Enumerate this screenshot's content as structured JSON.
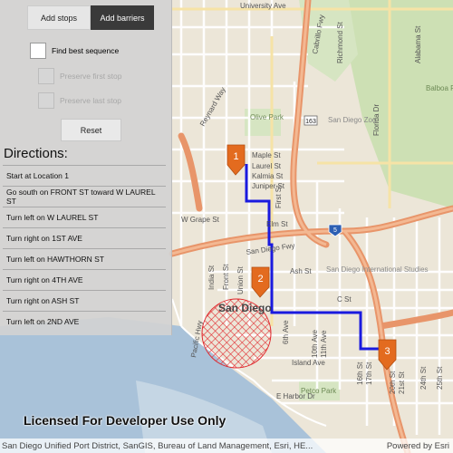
{
  "panel": {
    "tabs": [
      {
        "label": "Add stops",
        "active": false
      },
      {
        "label": "Add barriers",
        "active": true
      }
    ],
    "options": {
      "find_best_sequence": "Find best sequence",
      "preserve_first_stop": "Preserve first stop",
      "preserve_last_stop": "Preserve last stop"
    },
    "reset_label": "Reset",
    "directions_title": "Directions:",
    "directions": [
      "Start at Location 1",
      "Go south on FRONT ST toward W LAUREL ST",
      "Turn left on W LAUREL ST",
      "Turn right on 1ST AVE",
      "Turn left on HAWTHORN ST",
      "Turn right on 4TH AVE",
      "Turn right on ASH ST",
      "Turn left on 2ND AVE"
    ]
  },
  "map": {
    "stops": [
      "1",
      "2",
      "3"
    ],
    "city_label": "San Diego",
    "freeway_shield": "5",
    "route_shield": "163",
    "colors": {
      "route": "#1a1adf",
      "stop_marker": "#e36b1f",
      "barrier": "#e0262b",
      "freeway": "#e8956a",
      "water": "#a9c2d9",
      "park": "#cde0b4"
    },
    "labels": {
      "university_ave": "University Ave",
      "maple_st": "Maple St",
      "laurel_st": "Laurel St",
      "kalmia_st": "Kalmia St",
      "juniper_st": "Juniper St",
      "first_st": "First St",
      "elm_st": "Elm St",
      "ash_st": "Ash St",
      "c_st": "C St",
      "w_grape_st": "W Grape St",
      "cabrillo_fwy": "Cabrillo Fwy",
      "richmond_st": "Richmond St",
      "alabama_st": "Alabama St",
      "balboa_park": "Balboa Park",
      "san_diego_fwy": "San Diego Fwy",
      "san_diego_zoo": "San Diego Zoo",
      "florida_dr": "Florida Dr",
      "pacific_hwy": "Pacific Hwy",
      "india_st": "India St",
      "union_st": "Union St",
      "front_st": "Front St",
      "sixth_ave": "6th Ave",
      "tenth_ave": "10th Ave",
      "eleventh_ave": "11th Ave",
      "sixteenth_st": "16th St",
      "seventeenth_st": "17th St",
      "twentieth_st": "20th St",
      "twentyfirst_st": "21st St",
      "twentyfourth_st": "24th St",
      "twentyfifth_st": "25th St",
      "e_harbor_dr": "E Harbor Dr",
      "island_ave": "Island Ave",
      "petco_park": "Petco Park",
      "sd_intl_studies": "San Diego International Studies",
      "olive_park": "Olive Park",
      "reynard_way": "Reynard Way",
      "university_ave_top": "University Ave"
    }
  },
  "footer": {
    "license": "Licensed For Developer Use Only",
    "attribution": "San Diego Unified Port District, SanGIS, Bureau of Land Management, Esri, HE...",
    "powered_by": "Powered by Esri"
  }
}
